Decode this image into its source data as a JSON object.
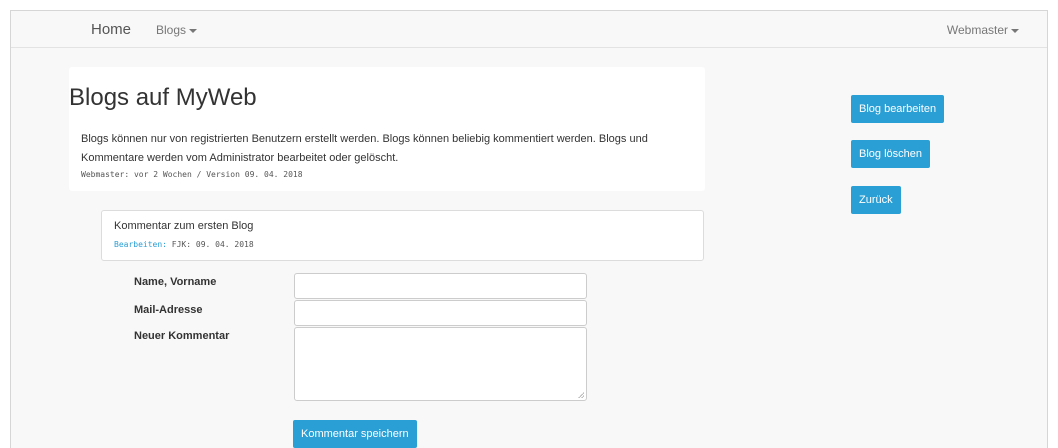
{
  "navbar": {
    "home_label": "Home",
    "blogs_label": "Blogs",
    "user_label": "Webmaster"
  },
  "blog": {
    "title": "Blogs auf MyWeb",
    "description": "Blogs können nur von registrierten Benutzern erstellt werden. Blogs können beliebig kommentiert werden. Blogs und Kommentare werden vom Administrator bearbeitet oder gelöscht.",
    "meta": "Webmaster: vor 2 Wochen / Version 09. 04. 2018"
  },
  "comment": {
    "title": "Kommentar zum ersten Blog",
    "edit_label": "Bearbeiten:",
    "meta": " FJK: 09. 04. 2018"
  },
  "form": {
    "name_label": "Name, Vorname",
    "name_value": "",
    "mail_label": "Mail-Adresse",
    "mail_value": "",
    "comment_label": "Neuer Kommentar",
    "comment_value": "",
    "submit_label": "Kommentar speichern"
  },
  "sidebar": {
    "edit_blog_label": "Blog bearbeiten",
    "delete_blog_label": "Blog löschen",
    "back_label": "Zurück"
  },
  "colors": {
    "primary": "#2a9fd6",
    "navbar_bg": "#f8f8f8"
  }
}
